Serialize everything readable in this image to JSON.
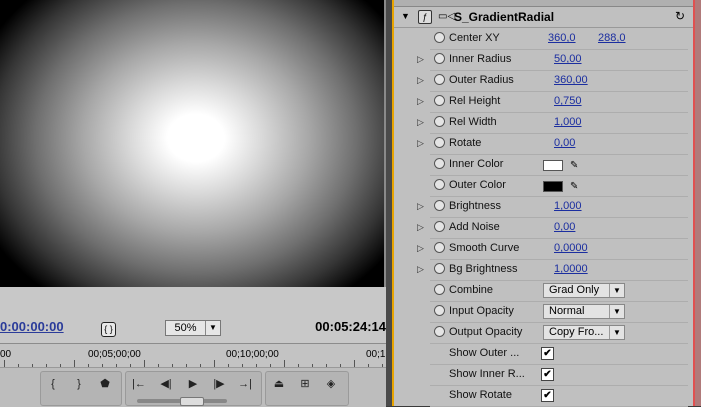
{
  "monitor": {
    "current_time": "0:00:00:00",
    "duration": "00:05:24:14",
    "zoom": "50%",
    "ruler": [
      "00",
      "00;05;00;00",
      "00;10;00;00",
      "00;1"
    ]
  },
  "effect": {
    "title": "S_GradientRadial",
    "params": [
      {
        "name": "Center XY",
        "value": "360,0",
        "value2": "288,0",
        "kind": "xy",
        "expand": false
      },
      {
        "name": "Inner Radius",
        "value": "50,00",
        "kind": "num",
        "expand": true
      },
      {
        "name": "Outer Radius",
        "value": "360,00",
        "kind": "num",
        "expand": true
      },
      {
        "name": "Rel Height",
        "value": "0,750",
        "kind": "num",
        "expand": true
      },
      {
        "name": "Rel Width",
        "value": "1,000",
        "kind": "num",
        "expand": true
      },
      {
        "name": "Rotate",
        "value": "0,00",
        "kind": "num",
        "expand": true
      },
      {
        "name": "Inner Color",
        "value": "",
        "kind": "color",
        "color": "#ffffff",
        "expand": false
      },
      {
        "name": "Outer Color",
        "value": "",
        "kind": "color",
        "color": "#000000",
        "expand": false
      },
      {
        "name": "Brightness",
        "value": "1,000",
        "kind": "num",
        "expand": true
      },
      {
        "name": "Add Noise",
        "value": "0,00",
        "kind": "num",
        "expand": true
      },
      {
        "name": "Smooth Curve",
        "value": "0,0000",
        "kind": "num",
        "expand": true
      },
      {
        "name": "Bg Brightness",
        "value": "1,0000",
        "kind": "num",
        "expand": true
      },
      {
        "name": "Combine",
        "value": "Grad Only",
        "kind": "select",
        "expand": false
      },
      {
        "name": "Input Opacity",
        "value": "Normal",
        "kind": "select",
        "expand": false
      },
      {
        "name": "Output Opacity",
        "value": "Copy Fro...",
        "kind": "select",
        "expand": false
      },
      {
        "name": "Show Outer ...",
        "value": "",
        "kind": "check",
        "expand": false
      },
      {
        "name": "Show Inner R...",
        "value": "",
        "kind": "check",
        "expand": false
      },
      {
        "name": "Show Rotate",
        "value": "",
        "kind": "check",
        "expand": false
      }
    ]
  },
  "colors": {
    "accent": "#e8a400",
    "link": "#1b2ea0",
    "timecode": "#2b3c9a"
  }
}
